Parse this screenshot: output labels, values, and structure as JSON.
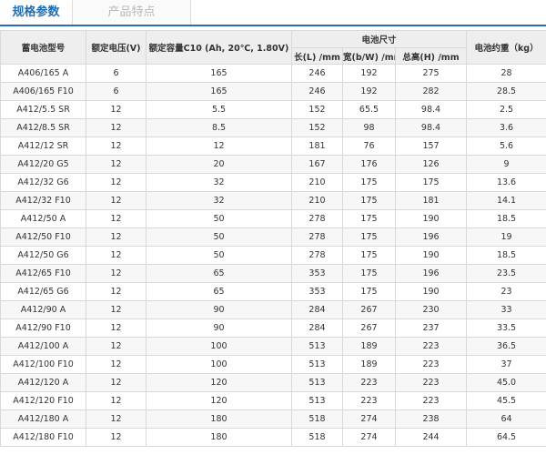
{
  "tabs": [
    {
      "label": "规格参数",
      "active": true
    },
    {
      "label": "产品特点",
      "active": false
    }
  ],
  "table": {
    "headers": {
      "model": "蓄电池型号",
      "voltage": "额定电压(V)",
      "capacity": "额定容量C10 (Ah, 20℃, 1.80V)",
      "dimensions": "电池尺寸",
      "length": "长(L) /mm",
      "width": "宽(b/W) /mm",
      "height": "总高(H) /mm",
      "weight": "电池约重（kg）"
    },
    "rows": [
      [
        "A406/165 A",
        "6",
        "165",
        "246",
        "192",
        "275",
        "28"
      ],
      [
        "A406/165 F10",
        "6",
        "165",
        "246",
        "192",
        "282",
        "28.5"
      ],
      [
        "A412/5.5 SR",
        "12",
        "5.5",
        "152",
        "65.5",
        "98.4",
        "2.5"
      ],
      [
        "A412/8.5 SR",
        "12",
        "8.5",
        "152",
        "98",
        "98.4",
        "3.6"
      ],
      [
        "A412/12 SR",
        "12",
        "12",
        "181",
        "76",
        "157",
        "5.6"
      ],
      [
        "A412/20 G5",
        "12",
        "20",
        "167",
        "176",
        "126",
        "9"
      ],
      [
        "A412/32 G6",
        "12",
        "32",
        "210",
        "175",
        "175",
        "13.6"
      ],
      [
        "A412/32 F10",
        "12",
        "32",
        "210",
        "175",
        "181",
        "14.1"
      ],
      [
        "A412/50 A",
        "12",
        "50",
        "278",
        "175",
        "190",
        "18.5"
      ],
      [
        "A412/50 F10",
        "12",
        "50",
        "278",
        "175",
        "196",
        "19"
      ],
      [
        "A412/50 G6",
        "12",
        "50",
        "278",
        "175",
        "190",
        "18.5"
      ],
      [
        "A412/65 F10",
        "12",
        "65",
        "353",
        "175",
        "196",
        "23.5"
      ],
      [
        "A412/65 G6",
        "12",
        "65",
        "353",
        "175",
        "190",
        "23"
      ],
      [
        "A412/90 A",
        "12",
        "90",
        "284",
        "267",
        "230",
        "33"
      ],
      [
        "A412/90 F10",
        "12",
        "90",
        "284",
        "267",
        "237",
        "33.5"
      ],
      [
        "A412/100 A",
        "12",
        "100",
        "513",
        "189",
        "223",
        "36.5"
      ],
      [
        "A412/100 F10",
        "12",
        "100",
        "513",
        "189",
        "223",
        "37"
      ],
      [
        "A412/120 A",
        "12",
        "120",
        "513",
        "223",
        "223",
        "45.0"
      ],
      [
        "A412/120 F10",
        "12",
        "120",
        "513",
        "223",
        "223",
        "45.5"
      ],
      [
        "A412/180 A",
        "12",
        "180",
        "518",
        "274",
        "238",
        "64"
      ],
      [
        "A412/180 F10",
        "12",
        "180",
        "518",
        "274",
        "244",
        "64.5"
      ]
    ]
  }
}
